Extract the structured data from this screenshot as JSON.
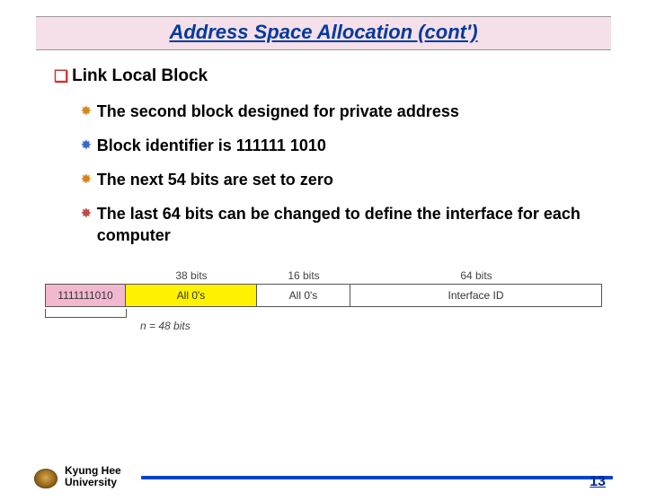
{
  "title": "Address Space Allocation (cont')",
  "section": {
    "icon": "q",
    "heading": "Link Local Block"
  },
  "bullets": [
    {
      "style": "orange",
      "text": "The second block designed for private address"
    },
    {
      "style": "blue",
      "text": "Block identifier is 111111 1010"
    },
    {
      "style": "orange",
      "text": "The next 54 bits are set to zero"
    },
    {
      "style": "red",
      "text": "The last 64 bits can be changed to define the interface for each computer"
    }
  ],
  "diagram": {
    "dims": [
      "",
      "38 bits",
      "16 bits",
      "64 bits"
    ],
    "cells": [
      "1111111010",
      "All 0's",
      "All 0's",
      "Interface ID"
    ],
    "nlabel": "n = 48 bits"
  },
  "footer": {
    "uni_line1": "Kyung Hee",
    "uni_line2": "University",
    "page": "13"
  }
}
